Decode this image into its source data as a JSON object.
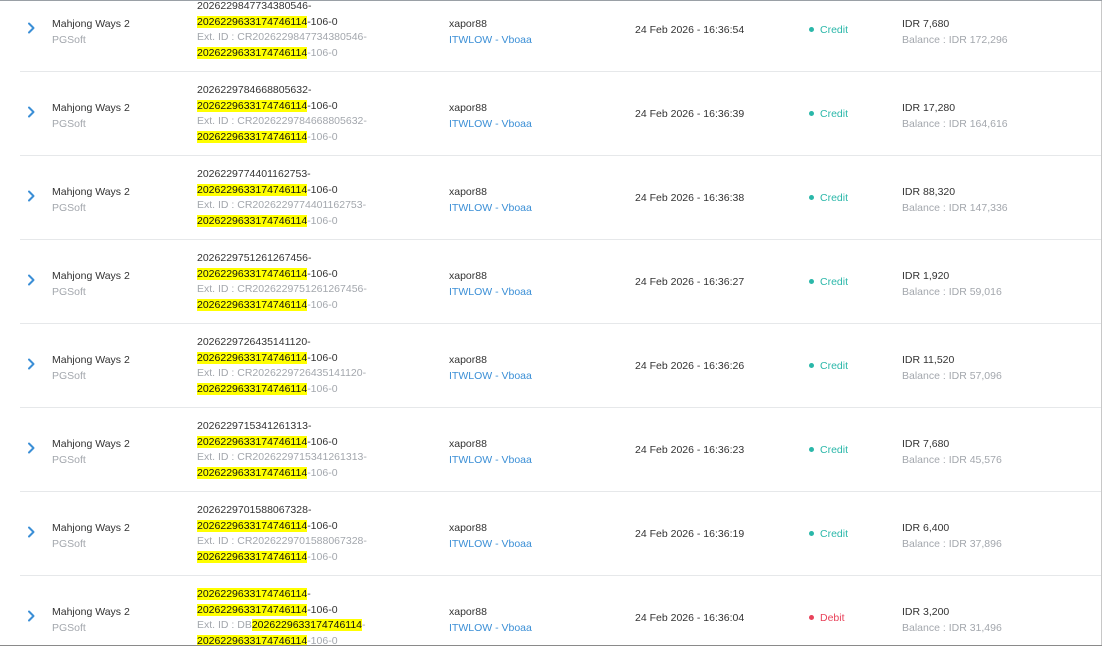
{
  "theme": {
    "credit_color": "#2ab7a9",
    "debit_color": "#e8425a",
    "link_color": "#3b8fd6",
    "highlight_color": "#ffff00"
  },
  "icons": {
    "expand": "chevron-right-icon"
  },
  "transactions": [
    {
      "game": "Mahjong Ways 2",
      "provider": "PGSoft",
      "id_lines": [
        {
          "kind": "main",
          "parts": [
            {
              "t": "2026229847734380546-",
              "hl": false
            }
          ]
        },
        {
          "kind": "main",
          "parts": [
            {
              "t": "2026229633174746114",
              "hl": true
            },
            {
              "t": "-106-0",
              "hl": false
            }
          ]
        },
        {
          "kind": "ext",
          "parts": [
            {
              "t": "Ext. ID : CR2026229847734380546-",
              "hl": false
            }
          ]
        },
        {
          "kind": "ext",
          "parts": [
            {
              "t": "2026229633174746114",
              "hl": true
            },
            {
              "t": "-106-0",
              "hl": false
            }
          ]
        }
      ],
      "player": "xapor88",
      "agent": "ITWLOW - Vboaa",
      "datetime": "24 Feb 2026 - 16:36:54",
      "status": "Credit",
      "status_type": "credit",
      "amount": "IDR 7,680",
      "balance": "Balance : IDR 172,296"
    },
    {
      "game": "Mahjong Ways 2",
      "provider": "PGSoft",
      "id_lines": [
        {
          "kind": "main",
          "parts": [
            {
              "t": "2026229784668805632-",
              "hl": false
            }
          ]
        },
        {
          "kind": "main",
          "parts": [
            {
              "t": "2026229633174746114",
              "hl": true
            },
            {
              "t": "-106-0",
              "hl": false
            }
          ]
        },
        {
          "kind": "ext",
          "parts": [
            {
              "t": "Ext. ID : CR2026229784668805632-",
              "hl": false
            }
          ]
        },
        {
          "kind": "ext",
          "parts": [
            {
              "t": "2026229633174746114",
              "hl": true
            },
            {
              "t": "-106-0",
              "hl": false
            }
          ]
        }
      ],
      "player": "xapor88",
      "agent": "ITWLOW - Vboaa",
      "datetime": "24 Feb 2026 - 16:36:39",
      "status": "Credit",
      "status_type": "credit",
      "amount": "IDR 17,280",
      "balance": "Balance : IDR 164,616"
    },
    {
      "game": "Mahjong Ways 2",
      "provider": "PGSoft",
      "id_lines": [
        {
          "kind": "main",
          "parts": [
            {
              "t": "2026229774401162753-",
              "hl": false
            }
          ]
        },
        {
          "kind": "main",
          "parts": [
            {
              "t": "2026229633174746114",
              "hl": true
            },
            {
              "t": "-106-0",
              "hl": false
            }
          ]
        },
        {
          "kind": "ext",
          "parts": [
            {
              "t": "Ext. ID : CR2026229774401162753-",
              "hl": false
            }
          ]
        },
        {
          "kind": "ext",
          "parts": [
            {
              "t": "2026229633174746114",
              "hl": true
            },
            {
              "t": "-106-0",
              "hl": false
            }
          ]
        }
      ],
      "player": "xapor88",
      "agent": "ITWLOW - Vboaa",
      "datetime": "24 Feb 2026 - 16:36:38",
      "status": "Credit",
      "status_type": "credit",
      "amount": "IDR 88,320",
      "balance": "Balance : IDR 147,336"
    },
    {
      "game": "Mahjong Ways 2",
      "provider": "PGSoft",
      "id_lines": [
        {
          "kind": "main",
          "parts": [
            {
              "t": "2026229751261267456-",
              "hl": false
            }
          ]
        },
        {
          "kind": "main",
          "parts": [
            {
              "t": "2026229633174746114",
              "hl": true
            },
            {
              "t": "-106-0",
              "hl": false
            }
          ]
        },
        {
          "kind": "ext",
          "parts": [
            {
              "t": "Ext. ID : CR2026229751261267456-",
              "hl": false
            }
          ]
        },
        {
          "kind": "ext",
          "parts": [
            {
              "t": "2026229633174746114",
              "hl": true
            },
            {
              "t": "-106-0",
              "hl": false
            }
          ]
        }
      ],
      "player": "xapor88",
      "agent": "ITWLOW - Vboaa",
      "datetime": "24 Feb 2026 - 16:36:27",
      "status": "Credit",
      "status_type": "credit",
      "amount": "IDR 1,920",
      "balance": "Balance : IDR 59,016"
    },
    {
      "game": "Mahjong Ways 2",
      "provider": "PGSoft",
      "id_lines": [
        {
          "kind": "main",
          "parts": [
            {
              "t": "2026229726435141120-",
              "hl": false
            }
          ]
        },
        {
          "kind": "main",
          "parts": [
            {
              "t": "2026229633174746114",
              "hl": true
            },
            {
              "t": "-106-0",
              "hl": false
            }
          ]
        },
        {
          "kind": "ext",
          "parts": [
            {
              "t": "Ext. ID : CR2026229726435141120-",
              "hl": false
            }
          ]
        },
        {
          "kind": "ext",
          "parts": [
            {
              "t": "2026229633174746114",
              "hl": true
            },
            {
              "t": "-106-0",
              "hl": false
            }
          ]
        }
      ],
      "player": "xapor88",
      "agent": "ITWLOW - Vboaa",
      "datetime": "24 Feb 2026 - 16:36:26",
      "status": "Credit",
      "status_type": "credit",
      "amount": "IDR 11,520",
      "balance": "Balance : IDR 57,096"
    },
    {
      "game": "Mahjong Ways 2",
      "provider": "PGSoft",
      "id_lines": [
        {
          "kind": "main",
          "parts": [
            {
              "t": "2026229715341261313-",
              "hl": false
            }
          ]
        },
        {
          "kind": "main",
          "parts": [
            {
              "t": "2026229633174746114",
              "hl": true
            },
            {
              "t": "-106-0",
              "hl": false
            }
          ]
        },
        {
          "kind": "ext",
          "parts": [
            {
              "t": "Ext. ID : CR2026229715341261313-",
              "hl": false
            }
          ]
        },
        {
          "kind": "ext",
          "parts": [
            {
              "t": "2026229633174746114",
              "hl": true
            },
            {
              "t": "-106-0",
              "hl": false
            }
          ]
        }
      ],
      "player": "xapor88",
      "agent": "ITWLOW - Vboaa",
      "datetime": "24 Feb 2026 - 16:36:23",
      "status": "Credit",
      "status_type": "credit",
      "amount": "IDR 7,680",
      "balance": "Balance : IDR 45,576"
    },
    {
      "game": "Mahjong Ways 2",
      "provider": "PGSoft",
      "id_lines": [
        {
          "kind": "main",
          "parts": [
            {
              "t": "2026229701588067328-",
              "hl": false
            }
          ]
        },
        {
          "kind": "main",
          "parts": [
            {
              "t": "2026229633174746114",
              "hl": true
            },
            {
              "t": "-106-0",
              "hl": false
            }
          ]
        },
        {
          "kind": "ext",
          "parts": [
            {
              "t": "Ext. ID : CR2026229701588067328-",
              "hl": false
            }
          ]
        },
        {
          "kind": "ext",
          "parts": [
            {
              "t": "2026229633174746114",
              "hl": true
            },
            {
              "t": "-106-0",
              "hl": false
            }
          ]
        }
      ],
      "player": "xapor88",
      "agent": "ITWLOW - Vboaa",
      "datetime": "24 Feb 2026 - 16:36:19",
      "status": "Credit",
      "status_type": "credit",
      "amount": "IDR 6,400",
      "balance": "Balance : IDR 37,896"
    },
    {
      "game": "Mahjong Ways 2",
      "provider": "PGSoft",
      "id_lines": [
        {
          "kind": "main",
          "parts": [
            {
              "t": "2026229633174746114",
              "hl": true
            },
            {
              "t": "-",
              "hl": false
            }
          ]
        },
        {
          "kind": "main",
          "parts": [
            {
              "t": "2026229633174746114",
              "hl": true
            },
            {
              "t": "-106-0",
              "hl": false
            }
          ]
        },
        {
          "kind": "ext",
          "parts": [
            {
              "t": "Ext. ID : DB",
              "hl": false
            },
            {
              "t": "2026229633174746114",
              "hl": true
            },
            {
              "t": "-",
              "hl": false
            }
          ]
        },
        {
          "kind": "ext",
          "parts": [
            {
              "t": "2026229633174746114",
              "hl": true
            },
            {
              "t": "-106-0",
              "hl": false
            }
          ]
        }
      ],
      "player": "xapor88",
      "agent": "ITWLOW - Vboaa",
      "datetime": "24 Feb 2026 - 16:36:04",
      "status": "Debit",
      "status_type": "debit",
      "amount": "IDR 3,200",
      "balance": "Balance : IDR 31,496"
    }
  ]
}
